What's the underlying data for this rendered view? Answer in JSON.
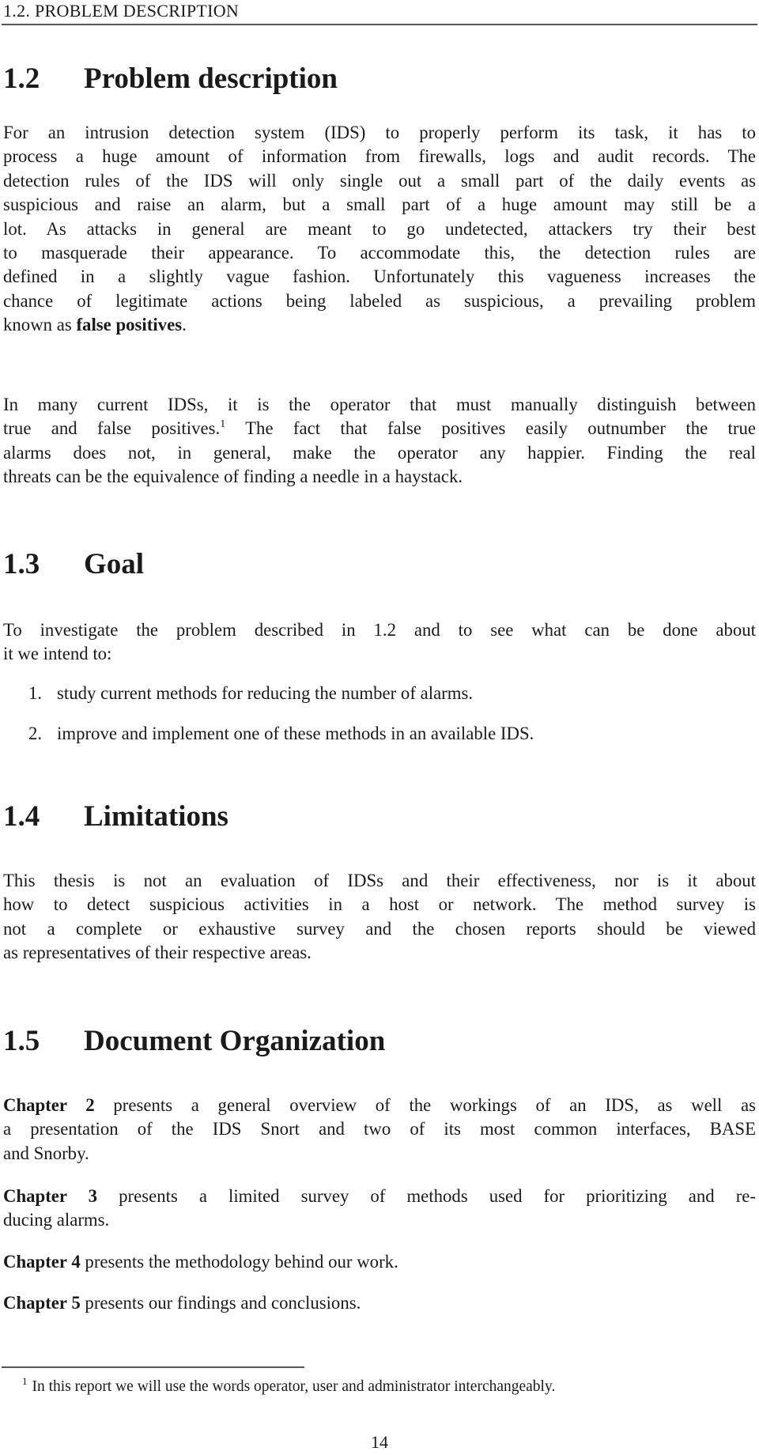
{
  "running_head": "1.2.  PROBLEM DESCRIPTION",
  "sections": {
    "problem": {
      "number": "1.2",
      "title": "Problem description",
      "para1_lines": [
        "For an intrusion detection system (IDS) to properly perform its task, it has to",
        "process a huge amount of information from firewalls, logs and audit records. The",
        "detection rules of the IDS will only single out a small part of the daily events as",
        "suspicious and raise an alarm, but a small part of a huge amount may still be a",
        "lot. As attacks in general are meant to go undetected, attackers try their best",
        "to masquerade their appearance. To accommodate this, the detection rules are",
        "defined in a slightly vague fashion. Unfortunately this vagueness increases the",
        "chance of legitimate actions being labeled as suspicious, a prevailing problem"
      ],
      "para1_last_prefix": "known as ",
      "para1_last_bold": "false positives",
      "para1_last_suffix": ".",
      "para2_line1": "In many current IDSs, it is the operator that must manually distinguish between",
      "para2_line2_a": "true and false positives.",
      "para2_footnote_mark": "1",
      "para2_line2_b": " The fact that false positives easily outnumber the true",
      "para2_line3": "alarms does not, in general, make the operator any happier. Finding the real",
      "para2_line4": "threats can be the equivalence of finding a needle in a haystack."
    },
    "goal": {
      "number": "1.3",
      "title": "Goal",
      "intro_lines": [
        "To investigate the problem described in 1.2 and to see what can be done about",
        "it we intend to:"
      ],
      "items": [
        {
          "marker": "1.",
          "text": "study current methods for reducing the number of alarms."
        },
        {
          "marker": "2.",
          "text": "improve and implement one of these methods in an available IDS."
        }
      ]
    },
    "limitations": {
      "number": "1.4",
      "title": "Limitations",
      "lines": [
        "This thesis is not an evaluation of IDSs and their effectiveness, nor is it about",
        "how to detect suspicious activities in a host or network. The method survey is",
        "not a complete or exhaustive survey and the chosen reports should be viewed",
        "as representatives of their respective areas."
      ]
    },
    "organization": {
      "number": "1.5",
      "title": "Document Organization",
      "chapters": [
        {
          "label": "Chapter 2",
          "lines": [
            " presents a general overview of the workings of an IDS, as well as",
            "a presentation of the IDS Snort and two of its most common interfaces, BASE",
            "and Snorby."
          ]
        },
        {
          "label": "Chapter 3",
          "lines": [
            " presents a limited survey of methods used for prioritizing and re-",
            "ducing alarms."
          ]
        },
        {
          "label": "Chapter 4",
          "lines": [
            " presents the methodology behind our work."
          ]
        },
        {
          "label": "Chapter 5",
          "lines": [
            " presents our findings and conclusions."
          ]
        }
      ]
    }
  },
  "footnote": {
    "mark": "1",
    "text": "In this report we will use the words operator, user and administrator interchangeably."
  },
  "page_number": "14"
}
